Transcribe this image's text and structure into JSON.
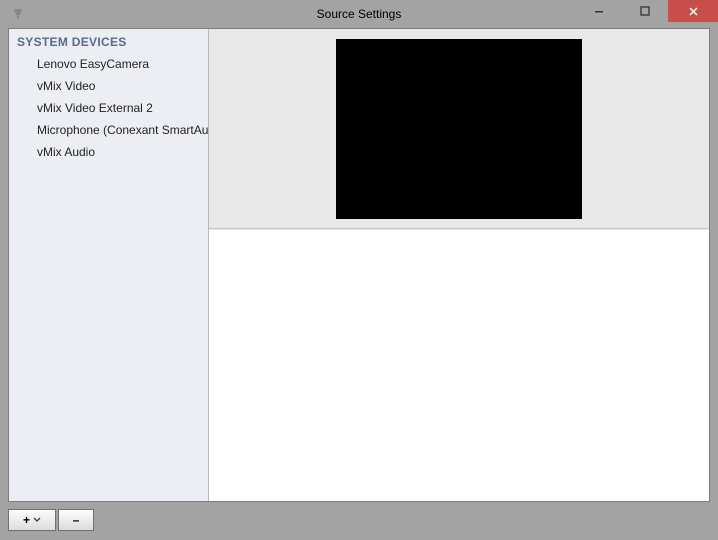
{
  "window": {
    "title": "Source Settings"
  },
  "sidebar": {
    "header": "SYSTEM DEVICES",
    "items": [
      {
        "label": "Lenovo EasyCamera"
      },
      {
        "label": "vMix Video"
      },
      {
        "label": "vMix Video External 2"
      },
      {
        "label": "Microphone (Conexant SmartAudi"
      },
      {
        "label": "vMix Audio"
      }
    ]
  },
  "toolbar": {
    "add_glyph": "+",
    "remove_glyph": "–"
  }
}
